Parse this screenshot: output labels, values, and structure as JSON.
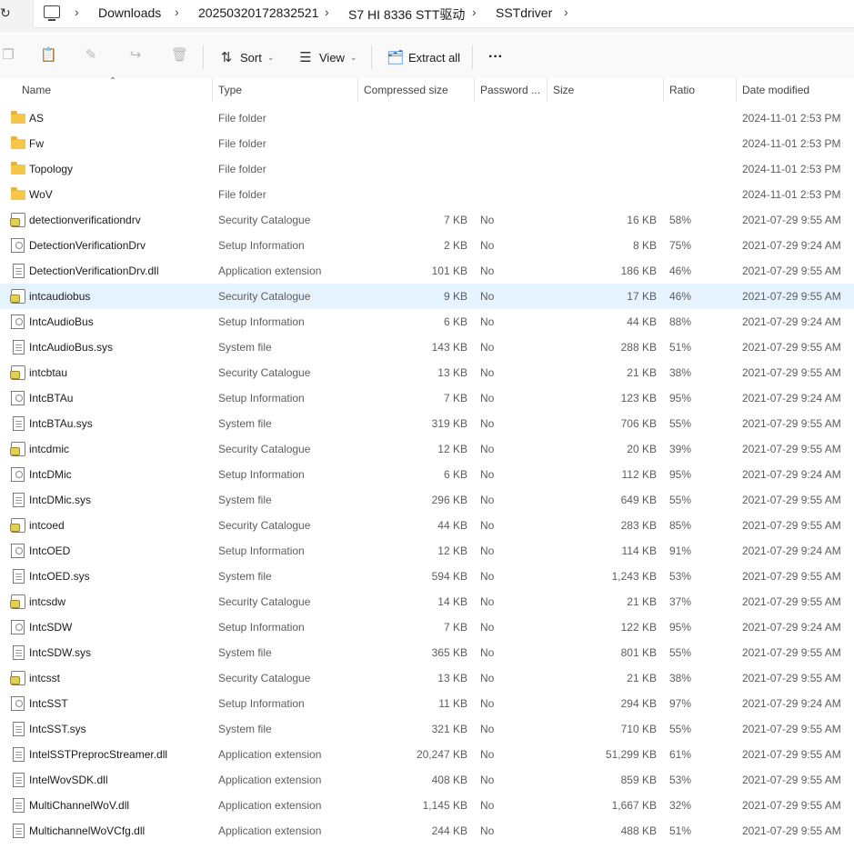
{
  "breadcrumb": [
    "Downloads",
    "20250320172832521",
    "S7 HI 8336 STT驱动",
    "SSTdriver"
  ],
  "toolbar": {
    "sort_label": "Sort",
    "view_label": "View",
    "extract_label": "Extract all",
    "more_label": "···"
  },
  "columns": {
    "name": "Name",
    "type": "Type",
    "compressed": "Compressed size",
    "password": "Password ...",
    "size": "Size",
    "ratio": "Ratio",
    "date": "Date modified"
  },
  "selected_row": "intcaudiobus",
  "rows": [
    {
      "icon": "folder-icon",
      "name": "AS",
      "type": "File folder",
      "comp": "",
      "pwd": "",
      "size": "",
      "ratio": "",
      "date": "2024-11-01 2:53 PM"
    },
    {
      "icon": "folder-icon",
      "name": "Fw",
      "type": "File folder",
      "comp": "",
      "pwd": "",
      "size": "",
      "ratio": "",
      "date": "2024-11-01 2:53 PM"
    },
    {
      "icon": "folder-icon",
      "name": "Topology",
      "type": "File folder",
      "comp": "",
      "pwd": "",
      "size": "",
      "ratio": "",
      "date": "2024-11-01 2:53 PM"
    },
    {
      "icon": "folder-icon",
      "name": "WoV",
      "type": "File folder",
      "comp": "",
      "pwd": "",
      "size": "",
      "ratio": "",
      "date": "2024-11-01 2:53 PM"
    },
    {
      "icon": "security-catalog-icon",
      "name": "detectionverificationdrv",
      "type": "Security Catalogue",
      "comp": "7 KB",
      "pwd": "No",
      "size": "16 KB",
      "ratio": "58%",
      "date": "2021-07-29 9:55 AM"
    },
    {
      "icon": "setup-info-icon",
      "name": "DetectionVerificationDrv",
      "type": "Setup Information",
      "comp": "2 KB",
      "pwd": "No",
      "size": "8 KB",
      "ratio": "75%",
      "date": "2021-07-29 9:24 AM"
    },
    {
      "icon": "file-icon",
      "name": "DetectionVerificationDrv.dll",
      "type": "Application extension",
      "comp": "101 KB",
      "pwd": "No",
      "size": "186 KB",
      "ratio": "46%",
      "date": "2021-07-29 9:55 AM"
    },
    {
      "icon": "security-catalog-icon",
      "name": "intcaudiobus",
      "type": "Security Catalogue",
      "comp": "9 KB",
      "pwd": "No",
      "size": "17 KB",
      "ratio": "46%",
      "date": "2021-07-29 9:55 AM"
    },
    {
      "icon": "setup-info-icon",
      "name": "IntcAudioBus",
      "type": "Setup Information",
      "comp": "6 KB",
      "pwd": "No",
      "size": "44 KB",
      "ratio": "88%",
      "date": "2021-07-29 9:24 AM"
    },
    {
      "icon": "file-icon",
      "name": "IntcAudioBus.sys",
      "type": "System file",
      "comp": "143 KB",
      "pwd": "No",
      "size": "288 KB",
      "ratio": "51%",
      "date": "2021-07-29 9:55 AM"
    },
    {
      "icon": "security-catalog-icon",
      "name": "intcbtau",
      "type": "Security Catalogue",
      "comp": "13 KB",
      "pwd": "No",
      "size": "21 KB",
      "ratio": "38%",
      "date": "2021-07-29 9:55 AM"
    },
    {
      "icon": "setup-info-icon",
      "name": "IntcBTAu",
      "type": "Setup Information",
      "comp": "7 KB",
      "pwd": "No",
      "size": "123 KB",
      "ratio": "95%",
      "date": "2021-07-29 9:24 AM"
    },
    {
      "icon": "file-icon",
      "name": "IntcBTAu.sys",
      "type": "System file",
      "comp": "319 KB",
      "pwd": "No",
      "size": "706 KB",
      "ratio": "55%",
      "date": "2021-07-29 9:55 AM"
    },
    {
      "icon": "security-catalog-icon",
      "name": "intcdmic",
      "type": "Security Catalogue",
      "comp": "12 KB",
      "pwd": "No",
      "size": "20 KB",
      "ratio": "39%",
      "date": "2021-07-29 9:55 AM"
    },
    {
      "icon": "setup-info-icon",
      "name": "IntcDMic",
      "type": "Setup Information",
      "comp": "6 KB",
      "pwd": "No",
      "size": "112 KB",
      "ratio": "95%",
      "date": "2021-07-29 9:24 AM"
    },
    {
      "icon": "file-icon",
      "name": "IntcDMic.sys",
      "type": "System file",
      "comp": "296 KB",
      "pwd": "No",
      "size": "649 KB",
      "ratio": "55%",
      "date": "2021-07-29 9:55 AM"
    },
    {
      "icon": "security-catalog-icon",
      "name": "intcoed",
      "type": "Security Catalogue",
      "comp": "44 KB",
      "pwd": "No",
      "size": "283 KB",
      "ratio": "85%",
      "date": "2021-07-29 9:55 AM"
    },
    {
      "icon": "setup-info-icon",
      "name": "IntcOED",
      "type": "Setup Information",
      "comp": "12 KB",
      "pwd": "No",
      "size": "114 KB",
      "ratio": "91%",
      "date": "2021-07-29 9:24 AM"
    },
    {
      "icon": "file-icon",
      "name": "IntcOED.sys",
      "type": "System file",
      "comp": "594 KB",
      "pwd": "No",
      "size": "1,243 KB",
      "ratio": "53%",
      "date": "2021-07-29 9:55 AM"
    },
    {
      "icon": "security-catalog-icon",
      "name": "intcsdw",
      "type": "Security Catalogue",
      "comp": "14 KB",
      "pwd": "No",
      "size": "21 KB",
      "ratio": "37%",
      "date": "2021-07-29 9:55 AM"
    },
    {
      "icon": "setup-info-icon",
      "name": "IntcSDW",
      "type": "Setup Information",
      "comp": "7 KB",
      "pwd": "No",
      "size": "122 KB",
      "ratio": "95%",
      "date": "2021-07-29 9:24 AM"
    },
    {
      "icon": "file-icon",
      "name": "IntcSDW.sys",
      "type": "System file",
      "comp": "365 KB",
      "pwd": "No",
      "size": "801 KB",
      "ratio": "55%",
      "date": "2021-07-29 9:55 AM"
    },
    {
      "icon": "security-catalog-icon",
      "name": "intcsst",
      "type": "Security Catalogue",
      "comp": "13 KB",
      "pwd": "No",
      "size": "21 KB",
      "ratio": "38%",
      "date": "2021-07-29 9:55 AM"
    },
    {
      "icon": "setup-info-icon",
      "name": "IntcSST",
      "type": "Setup Information",
      "comp": "11 KB",
      "pwd": "No",
      "size": "294 KB",
      "ratio": "97%",
      "date": "2021-07-29 9:24 AM"
    },
    {
      "icon": "file-icon",
      "name": "IntcSST.sys",
      "type": "System file",
      "comp": "321 KB",
      "pwd": "No",
      "size": "710 KB",
      "ratio": "55%",
      "date": "2021-07-29 9:55 AM"
    },
    {
      "icon": "file-icon",
      "name": "IntelSSTPreprocStreamer.dll",
      "type": "Application extension",
      "comp": "20,247 KB",
      "pwd": "No",
      "size": "51,299 KB",
      "ratio": "61%",
      "date": "2021-07-29 9:55 AM"
    },
    {
      "icon": "file-icon",
      "name": "IntelWovSDK.dll",
      "type": "Application extension",
      "comp": "408 KB",
      "pwd": "No",
      "size": "859 KB",
      "ratio": "53%",
      "date": "2021-07-29 9:55 AM"
    },
    {
      "icon": "file-icon",
      "name": "MultiChannelWoV.dll",
      "type": "Application extension",
      "comp": "1,145 KB",
      "pwd": "No",
      "size": "1,667 KB",
      "ratio": "32%",
      "date": "2021-07-29 9:55 AM"
    },
    {
      "icon": "file-icon",
      "name": "MultichannelWoVCfg.dll",
      "type": "Application extension",
      "comp": "244 KB",
      "pwd": "No",
      "size": "488 KB",
      "ratio": "51%",
      "date": "2021-07-29 9:55 AM"
    }
  ]
}
